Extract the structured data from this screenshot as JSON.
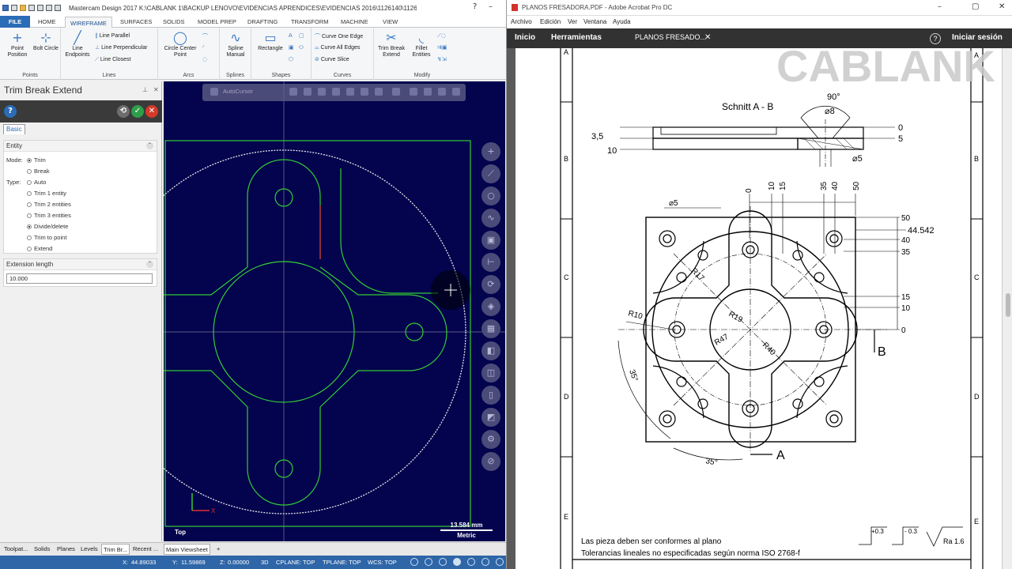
{
  "mastercam": {
    "title": "Mastercam Design 2017  K:\\CABLANK 1\\BACKUP LENOVO\\EVIDENCIAS APRENDICES\\EVIDENCIAS 2016\\1126140\\11261...",
    "tabs": [
      "FILE",
      "HOME",
      "WIREFRAME",
      "SURFACES",
      "SOLIDS",
      "MODEL PREP",
      "DRAFTING",
      "TRANSFORM",
      "MACHINE",
      "VIEW"
    ],
    "active_tab": "WIREFRAME",
    "ribbon": {
      "points": {
        "label": "Points",
        "point_position": "Point Position",
        "bolt_circle": "Bolt Circle"
      },
      "lines": {
        "label": "Lines",
        "line_endpoints": "Line Endpoints",
        "line_parallel": "Line Parallel",
        "line_perpendicular": "Line Perpendicular",
        "line_closest": "Line Closest"
      },
      "arcs": {
        "label": "Arcs",
        "circle_center_point": "Circle Center Point"
      },
      "splines": {
        "label": "Splines",
        "spline_manual": "Spline Manual"
      },
      "shapes": {
        "label": "Shapes",
        "rectangle": "Rectangle"
      },
      "curves": {
        "label": "Curves",
        "curve_one_edge": "Curve One Edge",
        "curve_all_edges": "Curve All Edges",
        "curve_slice": "Curve Slice"
      },
      "modify": {
        "label": "Modify",
        "trim_break_extend": "Trim Break Extend",
        "fillet_entities": "Fillet Entities"
      }
    },
    "panel": {
      "title": "Trim Break Extend",
      "tab": "Basic",
      "entity_section": "Entity",
      "mode_label": "Mode:",
      "type_label": "Type:",
      "modes": [
        "Trim",
        "Break"
      ],
      "selected_mode": "Trim",
      "types": [
        "Auto",
        "Trim 1 entity",
        "Trim 2 entities",
        "Trim 3 entities",
        "Divide/delete",
        "Trim to point",
        "Extend"
      ],
      "selected_type": "Divide/delete",
      "extension_section": "Extension length",
      "extension_value": "10.000"
    },
    "graphics": {
      "view_label": "Top",
      "scale_value": "13.584 mm",
      "scale_unit": "Metric",
      "axis_x": "X",
      "autocursor": "AutoCursor"
    },
    "bottom_tabs": [
      "Toolpat...",
      "Solids",
      "Planes",
      "Levels",
      "Trim Br...",
      "Recent ..."
    ],
    "viewsheet_tab": "Main Viewsheet",
    "status": {
      "x_label": "X:",
      "x": "44.89033",
      "y_label": "Y:",
      "y": "11.59869",
      "z_label": "Z:",
      "z": "0.00000",
      "mode": "3D",
      "cplane": "CPLANE: TOP",
      "tplane": "TPLANE: TOP",
      "wcs": "WCS: TOP"
    }
  },
  "acrobat": {
    "title": "PLANOS FRESADORA.PDF - Adobe Acrobat Pro DC",
    "menu": [
      "Archivo",
      "Edición",
      "Ver",
      "Ventana",
      "Ayuda"
    ],
    "nav": {
      "home": "Inicio",
      "tools": "Herramientas",
      "doc_tab": "PLANOS FRESADO...",
      "signin": "Iniciar sesión"
    },
    "watermark": "CABLANK",
    "drawing": {
      "section_title": "Schnitt A - B",
      "dims_section": [
        "90°",
        "⌀8",
        "3,5",
        "10",
        "0",
        "5",
        "⌀5"
      ],
      "top_dims": [
        "0",
        "10",
        "15",
        "35",
        "40",
        "50"
      ],
      "right_dims": [
        "50",
        "44.542",
        "40",
        "35",
        "15",
        "10",
        "0"
      ],
      "radii": [
        "R17",
        "R10",
        "R19",
        "R47",
        "R40"
      ],
      "angles": [
        "35°",
        "35°"
      ],
      "small_dia": "⌀5",
      "markers": [
        "B",
        "A"
      ],
      "border_letters": [
        "A",
        "B",
        "C",
        "D",
        "E"
      ],
      "note1": "Las pieza deben ser conformes al plano",
      "note2": "Tolerancias lineales no especificadas según norma ISO 2768-f",
      "tol1": "+0.3",
      "tol2": "- 0.3",
      "roughness": "Ra 1.6"
    }
  }
}
